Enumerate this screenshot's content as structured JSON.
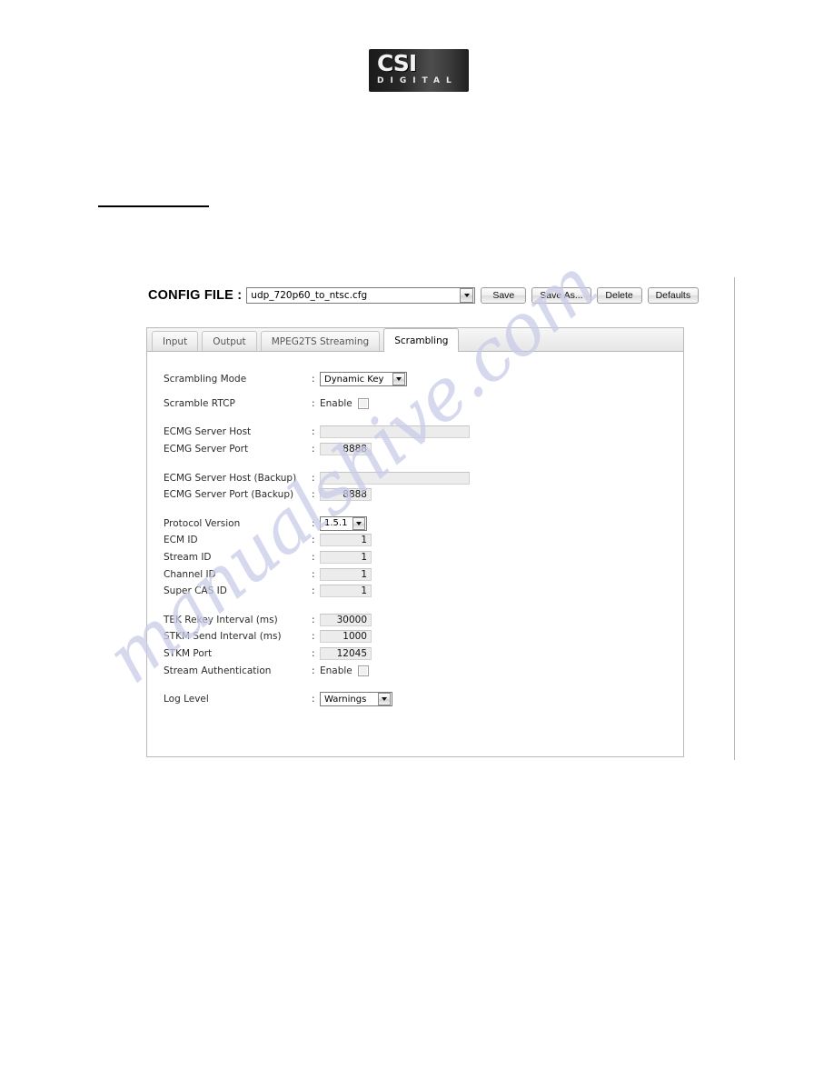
{
  "logo": {
    "primary": "CSI",
    "secondary": "DIGITAL"
  },
  "watermark": {
    "text": "manualshive.com"
  },
  "config_bar": {
    "label": "CONFIG FILE :",
    "selected_file": "udp_720p60_to_ntsc.cfg",
    "buttons": [
      {
        "label": "Save",
        "name": "save-button"
      },
      {
        "label": "Save As...",
        "name": "save-as-button"
      },
      {
        "label": "Delete",
        "name": "delete-button"
      },
      {
        "label": "Defaults",
        "name": "defaults-button"
      }
    ]
  },
  "tabs": [
    {
      "label": "Input",
      "active": false
    },
    {
      "label": "Output",
      "active": false
    },
    {
      "label": "MPEG2TS Streaming",
      "active": false
    },
    {
      "label": "Scrambling",
      "active": true
    }
  ],
  "form": {
    "colon": ":",
    "enable_label": "Enable",
    "scrambling_mode": {
      "label": "Scrambling Mode",
      "value": "Dynamic Key"
    },
    "scramble_rtcp": {
      "label": "Scramble RTCP",
      "checked": false
    },
    "ecmg_server_host": {
      "label": "ECMG Server Host",
      "value": ""
    },
    "ecmg_server_port": {
      "label": "ECMG Server Port",
      "value": "8888"
    },
    "ecmg_server_host_backup": {
      "label": "ECMG Server Host (Backup)",
      "value": ""
    },
    "ecmg_server_port_backup": {
      "label": "ECMG Server Port (Backup)",
      "value": "8888"
    },
    "protocol_version": {
      "label": "Protocol Version",
      "value": "1.5.1"
    },
    "ecm_id": {
      "label": "ECM ID",
      "value": "1"
    },
    "stream_id": {
      "label": "Stream ID",
      "value": "1"
    },
    "channel_id": {
      "label": "Channel ID",
      "value": "1"
    },
    "super_cas_id": {
      "label": "Super CAS ID",
      "value": "1"
    },
    "tek_rekey_interval": {
      "label": "TEK Rekey Interval (ms)",
      "value": "30000"
    },
    "stkm_send_interval": {
      "label": "STKM Send Interval (ms)",
      "value": "1000"
    },
    "stkm_port": {
      "label": "STKM Port",
      "value": "12045"
    },
    "stream_authentication": {
      "label": "Stream Authentication",
      "checked": false
    },
    "log_level": {
      "label": "Log Level",
      "value": "Warnings"
    }
  }
}
